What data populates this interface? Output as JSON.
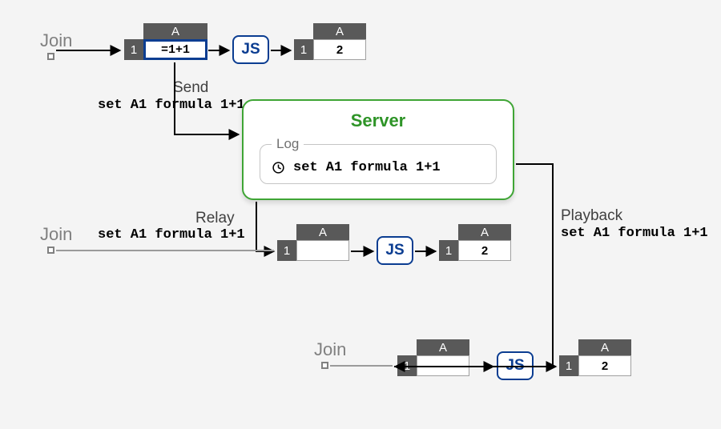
{
  "labels": {
    "join": "Join",
    "js": "JS",
    "col": "A",
    "row": "1",
    "formula": "=1+1",
    "result": "2"
  },
  "ops": {
    "send_label": "Send",
    "relay_label": "Relay",
    "playback_label": "Playback",
    "code": "set A1 formula 1+1"
  },
  "server": {
    "title": "Server",
    "log_label": "Log"
  }
}
